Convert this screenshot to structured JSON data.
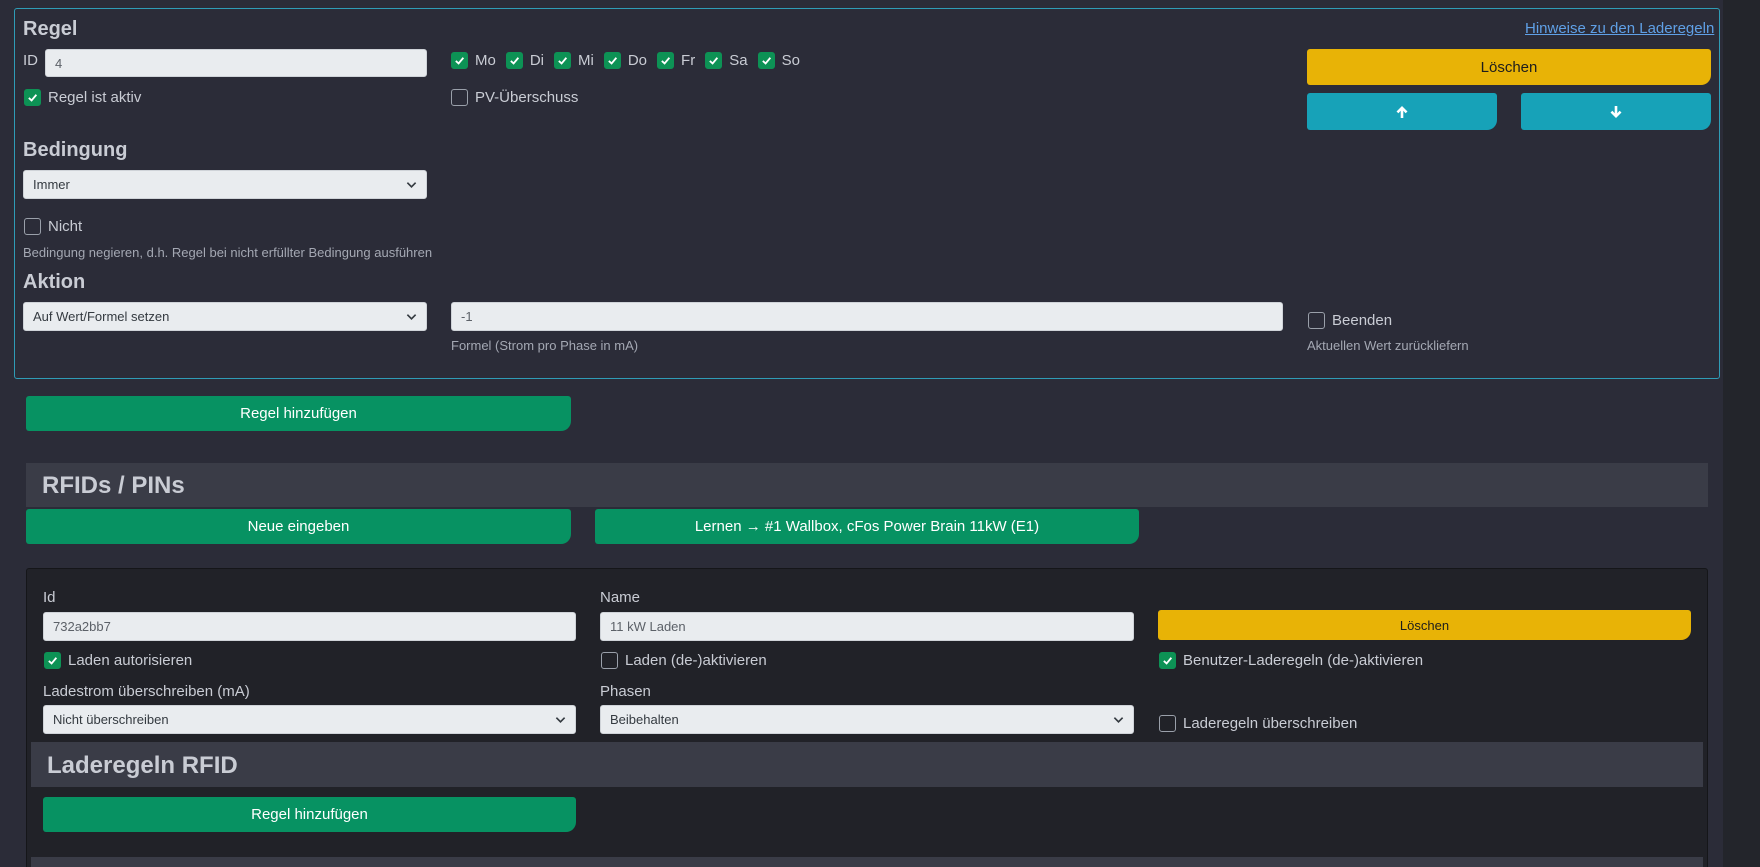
{
  "rule": {
    "title": "Regel",
    "hint_link": "Hinweise zu den Laderegeln",
    "id_label": "ID",
    "id_value": "4",
    "active_label": "Regel ist aktiv",
    "active_checked": true,
    "days": [
      {
        "label": "Mo",
        "checked": true
      },
      {
        "label": "Di",
        "checked": true
      },
      {
        "label": "Mi",
        "checked": true
      },
      {
        "label": "Do",
        "checked": true
      },
      {
        "label": "Fr",
        "checked": true
      },
      {
        "label": "Sa",
        "checked": true
      },
      {
        "label": "So",
        "checked": true
      }
    ],
    "pv_label": "PV-Überschuss",
    "pv_checked": false,
    "delete_label": "Löschen",
    "condition_title": "Bedingung",
    "condition_value": "Immer",
    "not_label": "Nicht",
    "not_checked": false,
    "not_help": "Bedingung negieren, d.h. Regel bei nicht erfüllter Bedingung ausführen",
    "action_title": "Aktion",
    "action_value": "Auf Wert/Formel setzen",
    "formula_value": "-1",
    "formula_help": "Formel (Strom pro Phase in mA)",
    "end_label": "Beenden",
    "end_checked": false,
    "end_help": "Aktuellen Wert zurückliefern"
  },
  "add_rule_label": "Regel hinzufügen",
  "rfid": {
    "title": "RFIDs / PINs",
    "new_label": "Neue eingeben",
    "learn_label": "Lernen → #1 Wallbox, cFos Power Brain 11kW (E1)",
    "card": {
      "id_label": "Id",
      "id_value": "732a2bb7",
      "name_label": "Name",
      "name_value": "11 kW Laden",
      "delete_label": "Löschen",
      "authorize_label": "Laden autorisieren",
      "authorize_checked": true,
      "toggle_charge_label": "Laden (de-)aktivieren",
      "toggle_charge_checked": false,
      "user_rules_label": "Benutzer-Laderegeln (de-)aktivieren",
      "user_rules_checked": true,
      "current_label": "Ladestrom überschreiben (mA)",
      "current_value": "Nicht überschreiben",
      "phases_label": "Phasen",
      "phases_value": "Beibehalten",
      "override_rules_label": "Laderegeln überschreiben",
      "override_rules_checked": false,
      "rules_title": "Laderegeln RFID",
      "add_rule_label": "Regel hinzufügen"
    }
  },
  "colors": {
    "accent_green": "#079262",
    "accent_yellow": "#e8b306",
    "accent_teal": "#17a2b8",
    "panel_border": "#2f9cb6"
  }
}
